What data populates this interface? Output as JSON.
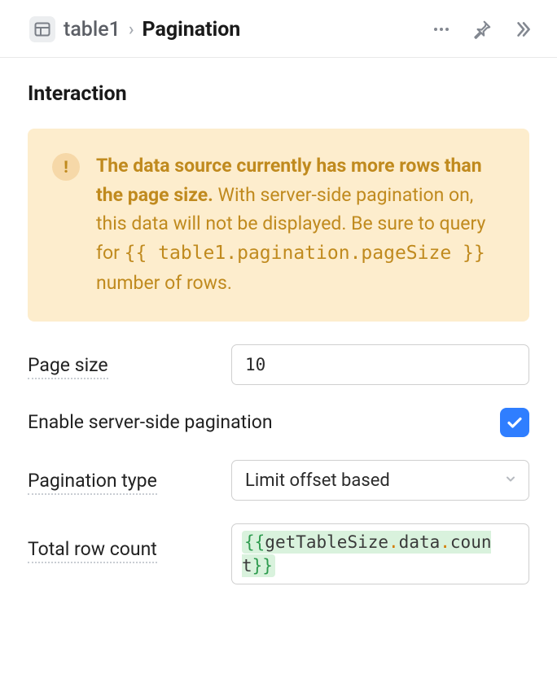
{
  "header": {
    "parent": "table1",
    "current": "Pagination"
  },
  "section_title": "Interaction",
  "alert": {
    "bold": "The data source currently has more rows than the page size.",
    "rest_before_code": " With server-side pagination on, this data will not be displayed. Be sure to query for ",
    "code": "{{ table1.pagination.pageSize }}",
    "rest_after_code": " number of rows."
  },
  "fields": {
    "page_size_label": "Page size",
    "page_size_value": "10",
    "enable_server_label": "Enable server-side pagination",
    "enable_server_checked": true,
    "pagination_type_label": "Pagination type",
    "pagination_type_value": "Limit offset based",
    "total_row_count_label": "Total row count",
    "total_row_count_expr": {
      "open": "{{",
      "ident1": "getTableSize",
      "dot1": ".",
      "ident2": "data",
      "dot2": ".",
      "ident3": "count",
      "close": "}}"
    }
  }
}
